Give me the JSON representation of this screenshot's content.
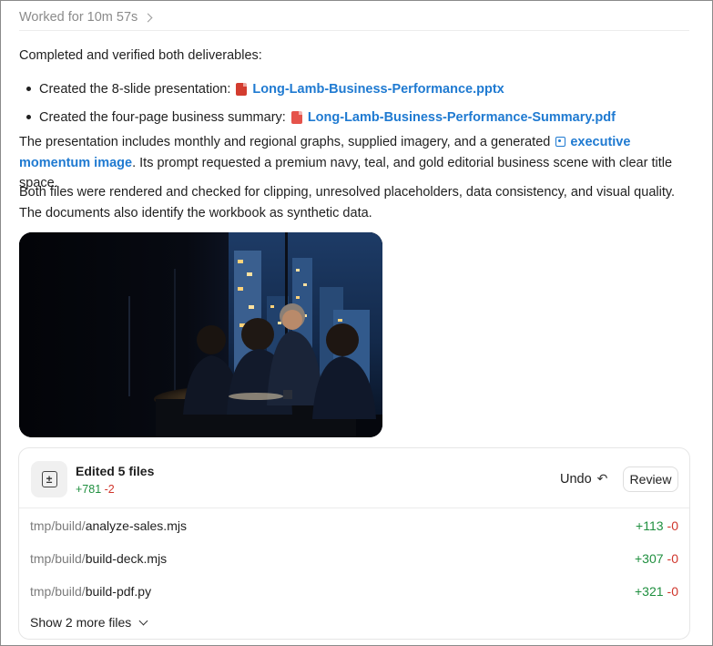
{
  "header": {
    "worked_label": "Worked for 10m 57s"
  },
  "message": {
    "intro": "Completed and verified both deliverables:",
    "items": [
      {
        "prefix": "Created the 8-slide presentation:",
        "file": "Long-Lamb-Business-Performance.pptx",
        "icon": "pptx-file-icon"
      },
      {
        "prefix": "Created the four-page business summary:",
        "file": "Long-Lamb-Business-Performance-Summary.pdf",
        "icon": "pdf-file-icon"
      }
    ],
    "p2_before": "The presentation includes monthly and regional graphs, supplied imagery, and a generated",
    "p2_link": "executive momentum image",
    "p2_after": ". Its prompt requested a premium navy, teal, and gold editorial business scene with clear title space.",
    "p3": "Both files were rendered and checked for clipping, unresolved placeholders, data consistency, and visual quality. The documents also identify the workbook as synthetic data."
  },
  "image": {
    "subject": "executive team meeting at night city office"
  },
  "changes": {
    "title": "Edited 5 files",
    "added": "+781",
    "removed": "-2",
    "undo_label": "Undo",
    "review_label": "Review",
    "files": [
      {
        "dir": "tmp/build/",
        "name": "analyze-sales.mjs",
        "added": "+113",
        "removed": "-0"
      },
      {
        "dir": "tmp/build/",
        "name": "build-deck.mjs",
        "added": "+307",
        "removed": "-0"
      },
      {
        "dir": "tmp/build/",
        "name": "build-pdf.py",
        "added": "+321",
        "removed": "-0"
      }
    ],
    "show_more_label": "Show 2 more files"
  },
  "colors": {
    "link": "#1f7ad1",
    "added": "#1f8f3f",
    "removed": "#d0352b"
  }
}
